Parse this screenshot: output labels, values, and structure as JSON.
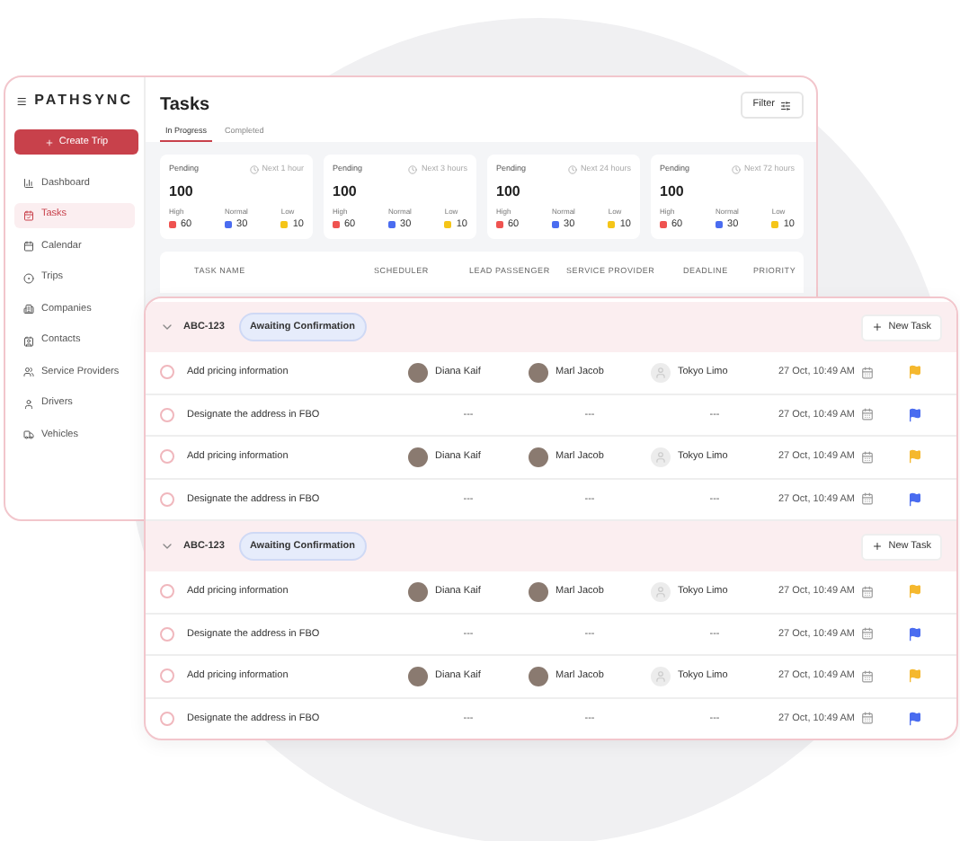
{
  "brand": {
    "name": "PATHSYNC"
  },
  "create_button": {
    "label": "Create Trip"
  },
  "sidebar": {
    "items": [
      {
        "label": "Dashboard",
        "selected": false
      },
      {
        "label": "Tasks",
        "selected": true
      },
      {
        "label": "Calendar",
        "selected": false
      },
      {
        "label": "Trips",
        "selected": false
      },
      {
        "label": "Companies",
        "selected": false
      },
      {
        "label": "Contacts",
        "selected": false
      },
      {
        "label": "Service Providers",
        "selected": false
      },
      {
        "label": "Drivers",
        "selected": false
      },
      {
        "label": "Vehicles",
        "selected": false
      }
    ]
  },
  "page": {
    "title": "Tasks",
    "filter_button": "Filter"
  },
  "tabs": [
    {
      "label": "In Progress",
      "selected": true
    },
    {
      "label": "Completed",
      "selected": false
    }
  ],
  "stat_cards": [
    {
      "label": "Pending",
      "window": "Next 1 hour",
      "total": "100",
      "breakdown": [
        {
          "label": "High",
          "value": "60",
          "color": "#ef5350"
        },
        {
          "label": "Normal",
          "value": "30",
          "color": "#4a6cf0"
        },
        {
          "label": "Low",
          "value": "10",
          "color": "#f5c518"
        }
      ]
    },
    {
      "label": "Pending",
      "window": "Next 3 hours",
      "total": "100",
      "breakdown": [
        {
          "label": "High",
          "value": "60",
          "color": "#ef5350"
        },
        {
          "label": "Normal",
          "value": "30",
          "color": "#4a6cf0"
        },
        {
          "label": "Low",
          "value": "10",
          "color": "#f5c518"
        }
      ]
    },
    {
      "label": "Pending",
      "window": "Next 24 hours",
      "total": "100",
      "breakdown": [
        {
          "label": "High",
          "value": "60",
          "color": "#ef5350"
        },
        {
          "label": "Normal",
          "value": "30",
          "color": "#4a6cf0"
        },
        {
          "label": "Low",
          "value": "10",
          "color": "#f5c518"
        }
      ]
    },
    {
      "label": "Pending",
      "window": "Next 72 hours",
      "total": "100",
      "breakdown": [
        {
          "label": "High",
          "value": "60",
          "color": "#ef5350"
        },
        {
          "label": "Normal",
          "value": "30",
          "color": "#4a6cf0"
        },
        {
          "label": "Low",
          "value": "10",
          "color": "#f5c518"
        }
      ]
    }
  ],
  "table": {
    "columns": [
      "TASK NAME",
      "SCHEDULER",
      "LEAD PASSENGER",
      "SERVICE PROVIDER",
      "DEADLINE",
      "PRIORITY"
    ]
  },
  "groups": [
    {
      "id": "ABC-123",
      "status": "Awaiting Confirmation",
      "expanded": true,
      "button": "New Task",
      "rows": [
        {
          "checked": false,
          "name": "Add pricing information",
          "scheduler": "Diana Kaif",
          "lead_passenger": "Marl Jacob",
          "service_provider": "Tokyo Limo",
          "deadline": "27 Oct, 10:49 AM",
          "color": "#f5b82e"
        },
        {
          "checked": false,
          "name": "Designate the address in FBO",
          "scheduler": "---",
          "lead_passenger": "---",
          "service_provider": "---",
          "deadline": "27 Oct, 10:49 AM",
          "color": "#4a6cf0"
        },
        {
          "checked": false,
          "name": "Add pricing information",
          "scheduler": "Diana Kaif",
          "lead_passenger": "Marl Jacob",
          "service_provider": "Tokyo Limo",
          "deadline": "27 Oct, 10:49 AM",
          "color": "#f5b82e"
        },
        {
          "checked": false,
          "name": "Designate the address in FBO",
          "scheduler": "---",
          "lead_passenger": "---",
          "service_provider": "---",
          "deadline": "27 Oct, 10:49 AM",
          "color": "#4a6cf0"
        }
      ]
    },
    {
      "id": "ABC-123",
      "status": "Awaiting Confirmation",
      "expanded": true,
      "button": "New Task",
      "rows": [
        {
          "checked": false,
          "name": "Add pricing information",
          "scheduler": "Diana Kaif",
          "lead_passenger": "Marl Jacob",
          "service_provider": "Tokyo Limo",
          "deadline": "27 Oct, 10:49 AM",
          "color": "#f5b82e"
        },
        {
          "checked": false,
          "name": "Designate the address in FBO",
          "scheduler": "---",
          "lead_passenger": "---",
          "service_provider": "---",
          "deadline": "27 Oct, 10:49 AM",
          "color": "#4a6cf0"
        },
        {
          "checked": false,
          "name": "Add pricing information",
          "scheduler": "Diana Kaif",
          "lead_passenger": "Marl Jacob",
          "service_provider": "Tokyo Limo",
          "deadline": "27 Oct, 10:49 AM",
          "color": "#f5b82e"
        },
        {
          "checked": false,
          "name": "Designate the address in FBO",
          "scheduler": "---",
          "lead_passenger": "---",
          "service_provider": "---",
          "deadline": "27 Oct, 10:49 AM",
          "color": "#4a6cf0"
        }
      ]
    }
  ]
}
